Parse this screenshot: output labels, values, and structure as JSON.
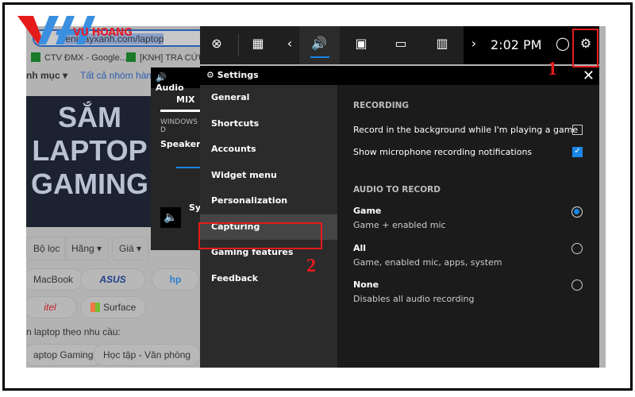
{
  "logo": {
    "text": "VU HOANG"
  },
  "browser": {
    "url": "dienmayxanh.com/laptop",
    "bookmarks": [
      "CTV ĐMX - Google...",
      "[KNH] TRA CỨU"
    ],
    "nav": [
      "nh mục ▾",
      "Tất cả nhóm hàng"
    ],
    "banner": [
      "SẮM",
      "LAPTOP",
      "GAMING"
    ],
    "filters": [
      "Bộ lọc",
      "Hãng ▾",
      "Giá ▾"
    ],
    "brands": [
      "MacBook",
      "ASUS",
      "hp",
      "itel",
      "Surface"
    ],
    "needs_label": "n laptop theo nhu cầu:",
    "needs": [
      "aptop Gaming",
      "Học tập - Văn phòng"
    ]
  },
  "gamebar": {
    "time": "2:02 PM",
    "icons": [
      "xbox-icon",
      "widget-icon",
      "chevron-left-icon",
      "audio-icon",
      "capture-icon",
      "performance-icon",
      "resources-icon",
      "chevron-right-icon",
      "mouse-icon",
      "gear-icon"
    ]
  },
  "audio": {
    "title": "Audio",
    "tab": "MIX",
    "section": "WINDOWS D",
    "device": "Speakers",
    "app": "Sy"
  },
  "settings": {
    "title": "Settings",
    "nav": [
      "General",
      "Shortcuts",
      "Accounts",
      "Widget menu",
      "Personalization",
      "Capturing",
      "Gaming features",
      "Feedback"
    ],
    "selected": "Capturing",
    "recording_header": "RECORDING",
    "record_bg": {
      "label": "Record in the background while I'm playing a game",
      "checked": false
    },
    "mic_notif": {
      "label": "Show microphone recording notifications",
      "checked": true
    },
    "audio_header": "AUDIO TO RECORD",
    "options": [
      {
        "label": "Game",
        "desc": "Game + enabled mic",
        "selected": true
      },
      {
        "label": "All",
        "desc": "Game, enabled mic, apps, system",
        "selected": false
      },
      {
        "label": "None",
        "desc": "Disables all audio recording",
        "selected": false
      }
    ]
  },
  "annotations": [
    "1",
    "2"
  ],
  "colors": {
    "accent": "#1a86e8",
    "annotation": "#e51b1b"
  }
}
